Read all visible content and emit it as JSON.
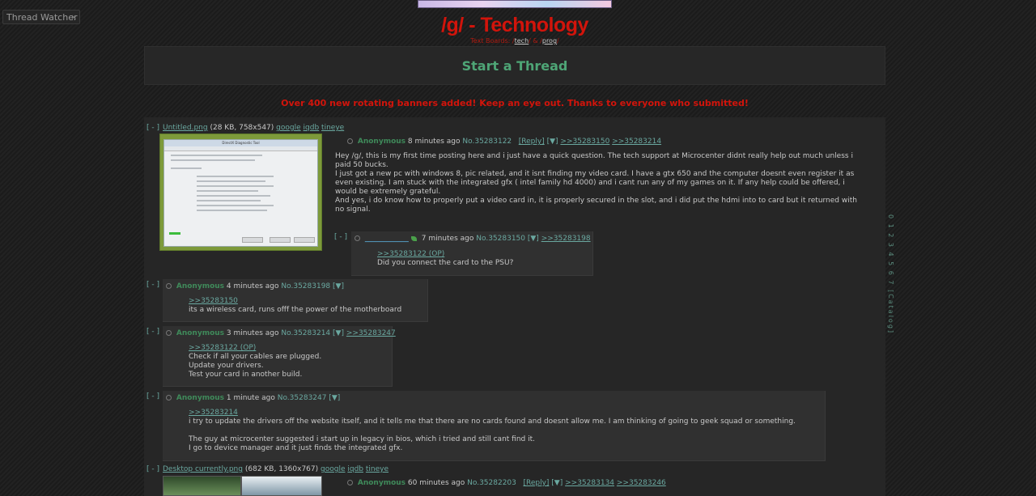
{
  "thread_watcher": {
    "label": "Thread Watcher",
    "close": "×"
  },
  "board": {
    "title": "/g/ - Technology",
    "subtitle_prefix": "Text Boards: /",
    "link_tech": "tech",
    "mid": "/ & /",
    "link_prog": "prog",
    "suffix": "/"
  },
  "start_thread": "Start a Thread",
  "announcement": "Over 400 new rotating banners added! Keep an eye out. Thanks to everyone who submitted!",
  "hide_toggle": "[ - ]",
  "op": {
    "file_link": "Untitled.png",
    "file_info": "(28 KB, 758x547)",
    "google": "google",
    "iqdb": "iqdb",
    "tineye": "tineye",
    "name": "Anonymous",
    "time": "8 minutes ago",
    "no": "No.35283122",
    "reply_btn": "[Reply]",
    "menu": "[▼]",
    "backlinks": [
      ">>35283150",
      ">>35283214"
    ],
    "lines": [
      "Hey /g/, this is my first time posting here and i just have a quick question. The tech support at Microcenter didnt really help out much unless i",
      "paid 50 bucks.",
      "",
      "I just got a new pc with windows 8, pic related, and it isnt finding my video card. I have a gtx 650 and the computer doesnt even register it as",
      "even existing. I am stuck with the integrated gfx ( intel family hd 4000) and i cant run any of my games on it. If any help could be offered, i",
      "would be extremely grateful.",
      "And yes, i do know how to properly put a video card in, it is properly secured in the slot, and i did put the hdmi into to card but it returned with",
      "no signal."
    ],
    "thumb_title": "DirectX Diagnostic Tool"
  },
  "reply_inline": {
    "name": "____________",
    "time": "7 minutes ago",
    "no": "No.35283150",
    "menu": "[▼]",
    "backlink": ">>35283198",
    "quote": ">>35283122 (OP)",
    "lines": [
      "Did you connect the card to the PSU?"
    ]
  },
  "replies": [
    {
      "name": "Anonymous",
      "time": "4 minutes ago",
      "no": "No.35283198",
      "menu": "[▼]",
      "backlink": "",
      "quote": ">>35283150",
      "lines": [
        "its a wireless card, runs offf the power of the motherboard"
      ]
    },
    {
      "name": "Anonymous",
      "time": "3 minutes ago",
      "no": "No.35283214",
      "menu": "[▼]",
      "backlink": ">>35283247",
      "quote": ">>35283122 (OP)",
      "lines": [
        "Check if all your cables are plugged.",
        "Update your drivers.",
        "Test your card in another build."
      ]
    },
    {
      "name": "Anonymous",
      "time": "1 minute ago",
      "no": "No.35283247",
      "menu": "[▼]",
      "backlink": "",
      "quote": ">>35283214",
      "lines": [
        "i try to update the drivers off the website itself, and it tells me that there are no cards found and doesnt allow me. I am thinking of going to geek squad or something.",
        "",
        "The guy at microcenter suggested i start up in legacy in bios, which i tried and still cant find it.",
        "I go to device manager and it just finds the integrated gfx."
      ]
    }
  ],
  "op2": {
    "file_link": "Desktop currently.png",
    "file_info": "(682 KB, 1360x767)",
    "google": "google",
    "iqdb": "iqdb",
    "tineye": "tineye",
    "name": "Anonymous",
    "time": "60 minutes ago",
    "no": "No.35282203",
    "reply_btn": "[Reply]",
    "menu": "[▼]",
    "backlinks": [
      ">>35283134",
      ">>35283246"
    ]
  },
  "side_nav": "0 1 2 3 4 5 6 7 [Catalog]"
}
